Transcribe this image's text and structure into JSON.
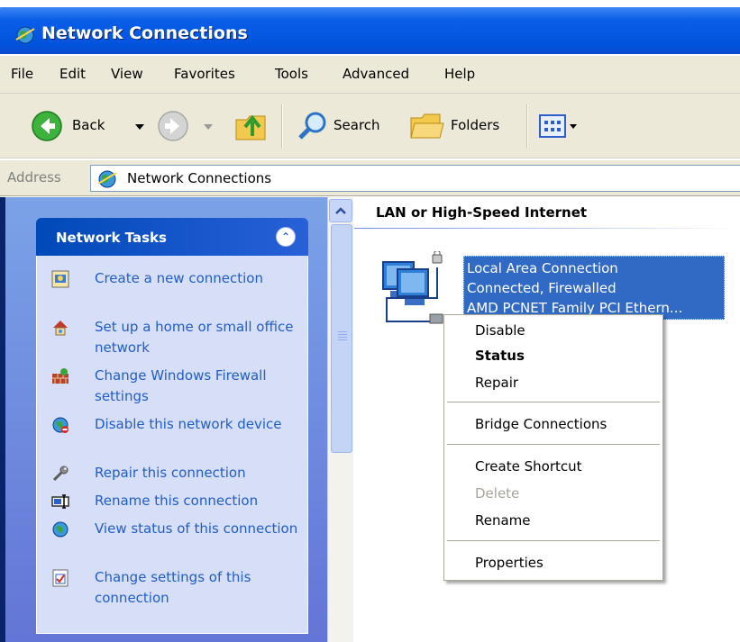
{
  "window": {
    "title": "Network Connections"
  },
  "menubar": [
    "File",
    "Edit",
    "View",
    "Favorites",
    "Tools",
    "Advanced",
    "Help"
  ],
  "toolbar": {
    "back": "Back",
    "search": "Search",
    "folders": "Folders"
  },
  "address": {
    "label": "Address",
    "value": "Network Connections"
  },
  "tasks": {
    "title": "Network Tasks",
    "items": [
      {
        "label": "Create a new connection",
        "icon": "new-connection-icon"
      },
      {
        "label": "Set up a home or small office network",
        "icon": "home-network-icon"
      },
      {
        "label": "Change Windows Firewall settings",
        "icon": "firewall-icon"
      },
      {
        "label": "Disable this network device",
        "icon": "disable-network-icon"
      },
      {
        "label": "Repair this connection",
        "icon": "wrench-icon"
      },
      {
        "label": "Rename this connection",
        "icon": "rename-icon"
      },
      {
        "label": "View status of this connection",
        "icon": "status-icon"
      },
      {
        "label": "Change settings of this connection",
        "icon": "settings-icon"
      }
    ]
  },
  "main": {
    "group_title": "LAN or High-Speed Internet",
    "connection": {
      "name": "Local Area Connection",
      "status": "Connected, Firewalled",
      "device": "AMD PCNET Family PCI Ethern..."
    }
  },
  "context_menu": {
    "disable": "Disable",
    "status": "Status",
    "repair": "Repair",
    "bridge": "Bridge Connections",
    "create_shortcut": "Create Shortcut",
    "delete": "Delete",
    "rename": "Rename",
    "properties": "Properties"
  }
}
